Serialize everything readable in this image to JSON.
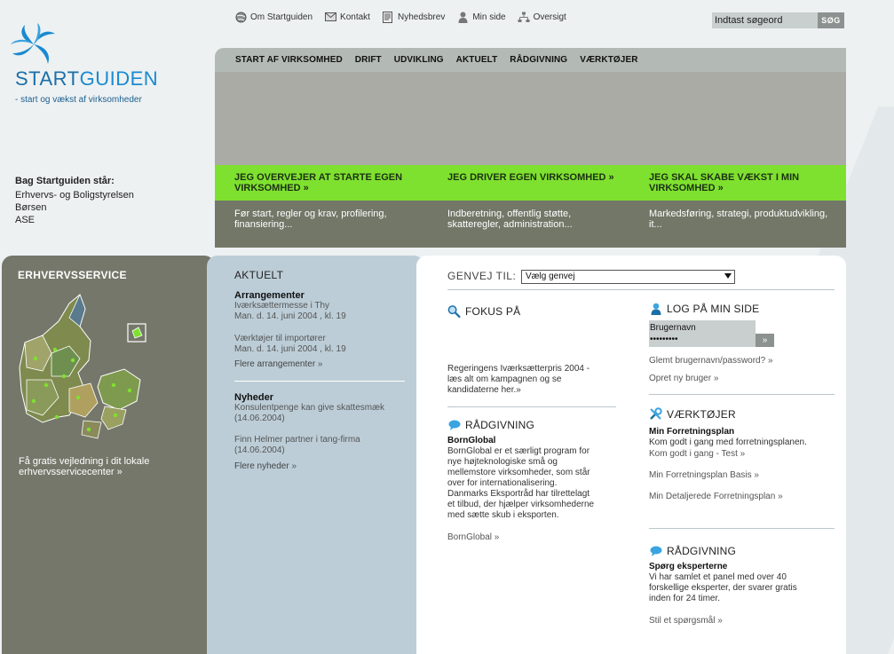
{
  "util_nav": [
    {
      "label": "Om Startguiden",
      "icon": "globe-icon"
    },
    {
      "label": "Kontakt",
      "icon": "envelope-icon"
    },
    {
      "label": "Nyhedsbrev",
      "icon": "newsletter-icon"
    },
    {
      "label": "Min side",
      "icon": "person-icon"
    },
    {
      "label": "Oversigt",
      "icon": "sitemap-icon"
    }
  ],
  "search": {
    "placeholder": "Indtast søgeord",
    "button": "SØG"
  },
  "logo": {
    "text_start": "START",
    "text_end": "GUIDEN",
    "tagline": "- start og vækst af virksomheder"
  },
  "backers": {
    "heading": "Bag Startguiden står:",
    "items": [
      "Erhvervs- og Boligstyrelsen",
      "Børsen",
      "ASE"
    ]
  },
  "main_nav": [
    "START AF VIRKSOMHED",
    "DRIFT",
    "UDVIKLING",
    "AKTUELT",
    "RÅDGIVNING",
    "VÆRKTØJER"
  ],
  "paths": [
    {
      "title_1": "JEG OVERVEJER AT STARTE EGEN",
      "title_2": "VIRKSOMHED",
      "desc_1": "Før start, regler og krav, profilering,",
      "desc_2": "finansiering..."
    },
    {
      "title_1": "JEG DRIVER EGEN VIRKSOMHED",
      "title_2": "",
      "desc_1": "Indberetning, offentlig støtte,",
      "desc_2": "skatteregler, administration..."
    },
    {
      "title_1": "JEG SKAL SKABE VÆKST I MIN",
      "title_2": "VIRKSOMHED",
      "desc_1": "Markedsføring, strategi, produktudvikling,",
      "desc_2": "it..."
    }
  ],
  "erhvervsservice": {
    "title": "ERHVERVSSERVICE",
    "link_1": "Få gratis vejledning i dit lokale",
    "link_2": "erhvervsservicecenter"
  },
  "aktuelt": {
    "title": "AKTUELT",
    "events_heading": "Arrangementer",
    "events": [
      {
        "title": "Iværksættermesse i Thy",
        "date": "Man. d. 14. juni 2004 , kl. 19"
      },
      {
        "title": "Værktøjer til importører",
        "date": "Man. d. 14. juni 2004 , kl. 19"
      }
    ],
    "events_more": "Flere arrangementer",
    "news_heading": "Nyheder",
    "news": [
      {
        "title": "Konsulentpenge kan give skattesmæk",
        "date": "(14.06.2004)"
      },
      {
        "title": "Finn Helmer partner i tang-firma",
        "date": "(14.06.2004)"
      }
    ],
    "news_more": "Flere nyheder"
  },
  "genvej": {
    "label": "GENVEJ TIL:",
    "selected": "Vælg genvej"
  },
  "fokus": {
    "title": "FOKUS PÅ",
    "lines": [
      "Regeringens Iværksætterpris 2004 -",
      "læs alt om kampagnen og se",
      "kandidaterne her."
    ]
  },
  "raadgivning1": {
    "title": "RÅDGIVNING",
    "heading": "BornGlobal",
    "lines": [
      "BornGlobal er et særligt program for",
      "nye højteknologiske små og",
      "mellemstore virksomheder, som står",
      "over for internationalisering.",
      "Danmarks Eksportråd har tilrettelagt",
      "et tilbud, der hjælper virksomhederne",
      "med sætte skub i eksporten."
    ],
    "link": "BornGlobal"
  },
  "login": {
    "title": "LOG PÅ MIN SIDE",
    "username": "Brugernavn",
    "password": "•••••••••",
    "forgot": "Glemt brugernavn/password?",
    "create": "Opret ny bruger"
  },
  "vaerktoejer": {
    "title": "VÆRKTØJER",
    "heading": "Min Forretningsplan",
    "desc": "Kom godt i gang med forretningsplanen.",
    "links": [
      "Kom godt i gang - Test",
      "Min Forretningsplan Basis",
      "Min Detaljerede Forretningsplan"
    ]
  },
  "raadgivning2": {
    "title": "RÅDGIVNING",
    "heading": "Spørg eksperterne",
    "lines": [
      "Vi har samlet et panel med over 40",
      "forskellige eksperter, der svarer gratis",
      "inden for 24 timer."
    ],
    "link": "Stil et spørgsmål"
  },
  "colors": {
    "brand_blue": "#1b6fa8",
    "accent_green": "#7fe12f",
    "panel_olive": "#75776a",
    "panel_blue": "#bccdd7"
  }
}
